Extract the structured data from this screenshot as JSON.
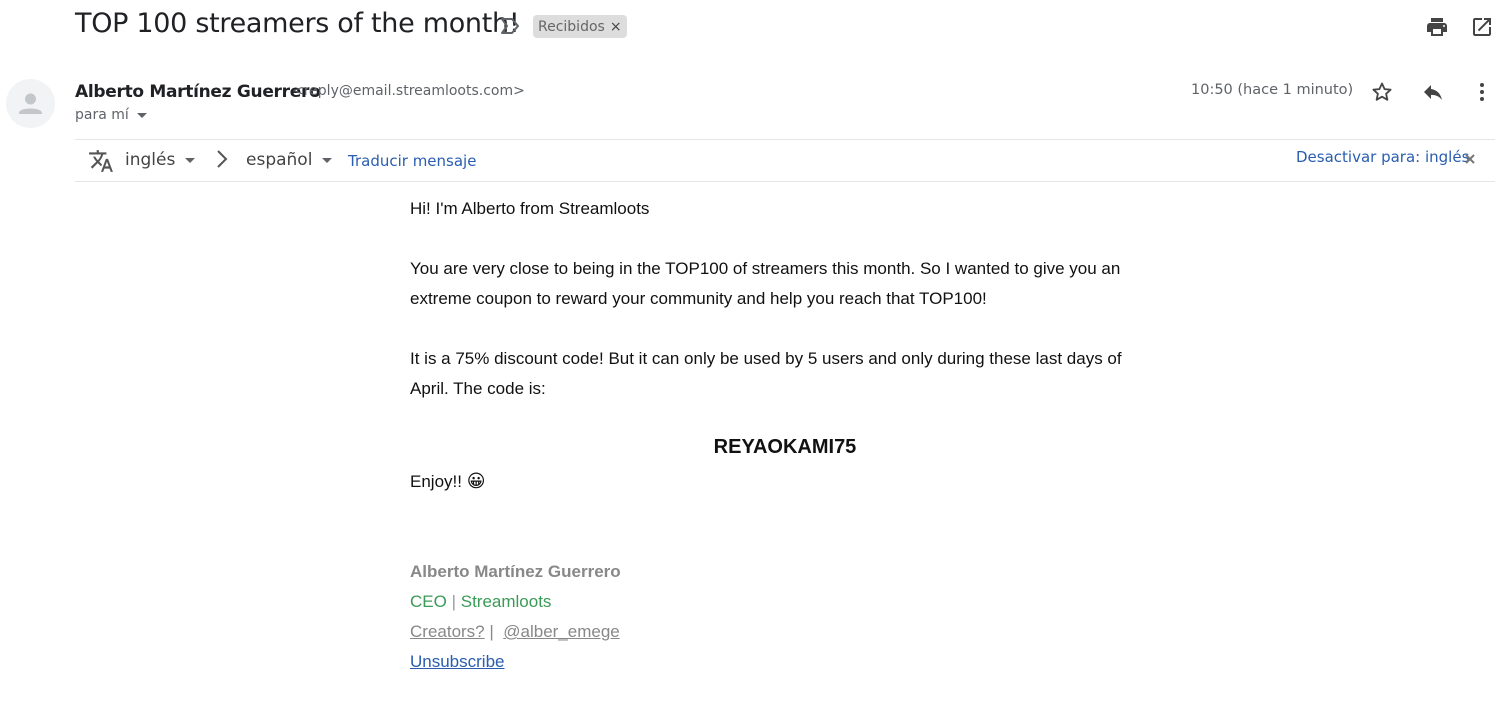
{
  "subject": "TOP 100 streamers of the month!",
  "label": {
    "text": "Recibidos",
    "remove": "×"
  },
  "sender": {
    "name": "Alberto Martínez Guerrero",
    "email": "<reply@email.streamloots.com>",
    "to": "para mí"
  },
  "time": "10:50 (hace 1 minuto)",
  "translate": {
    "from": "inglés",
    "to": "español",
    "action": "Traducir mensaje",
    "disable": "Desactivar para: inglés"
  },
  "message": {
    "greeting": "Hi! I'm Alberto from Streamloots",
    "para1_line1": "You are very close to being in the TOP100 of streamers this month. So I wanted to give you an",
    "para1_line2": "extreme coupon to reward your community and help you reach that TOP100!",
    "para2_line1": "It is a 75% discount code! But it can only be used by 5 users and only during these last days of",
    "para2_line2": "April. The code is:",
    "code": "REYAOKAMI75",
    "closing": "Enjoy!!",
    "closing_emoji": "😀"
  },
  "signature": {
    "name": "Alberto Martínez Guerrero",
    "role": "CEO",
    "separator": "|",
    "company": "Streamloots",
    "link1": "Creators?",
    "link_sep": "|",
    "link2": "@alber_emege",
    "unsubscribe": "Unsubscribe"
  },
  "colors": {
    "link": "#2a5db0",
    "signature_green": "#3b9a57",
    "muted": "#5f6368"
  }
}
